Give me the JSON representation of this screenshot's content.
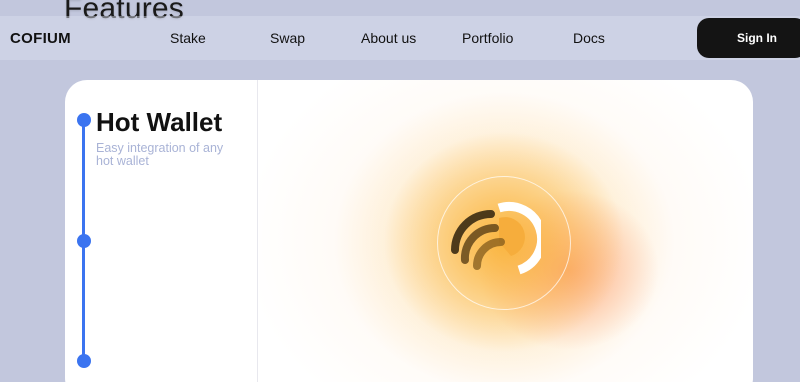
{
  "section": {
    "heading": "Features"
  },
  "header": {
    "logo": "COFIUM",
    "nav": [
      "Stake",
      "Swap",
      "About us",
      "Portfolio",
      "Docs"
    ],
    "signin_label": "Sign In"
  },
  "feature": {
    "title": "Hot Wallet",
    "description": "Easy integration of any hot wallet",
    "steps_total": 3,
    "active_step": 1
  },
  "colors": {
    "accent": "#3b74f0",
    "button_bg": "#141414",
    "page_bg": "#c2c7dd",
    "description": "#a9b3d6",
    "glow": "#fab43c"
  },
  "icons": {
    "feature_icon": "hot-wallet-icon"
  }
}
